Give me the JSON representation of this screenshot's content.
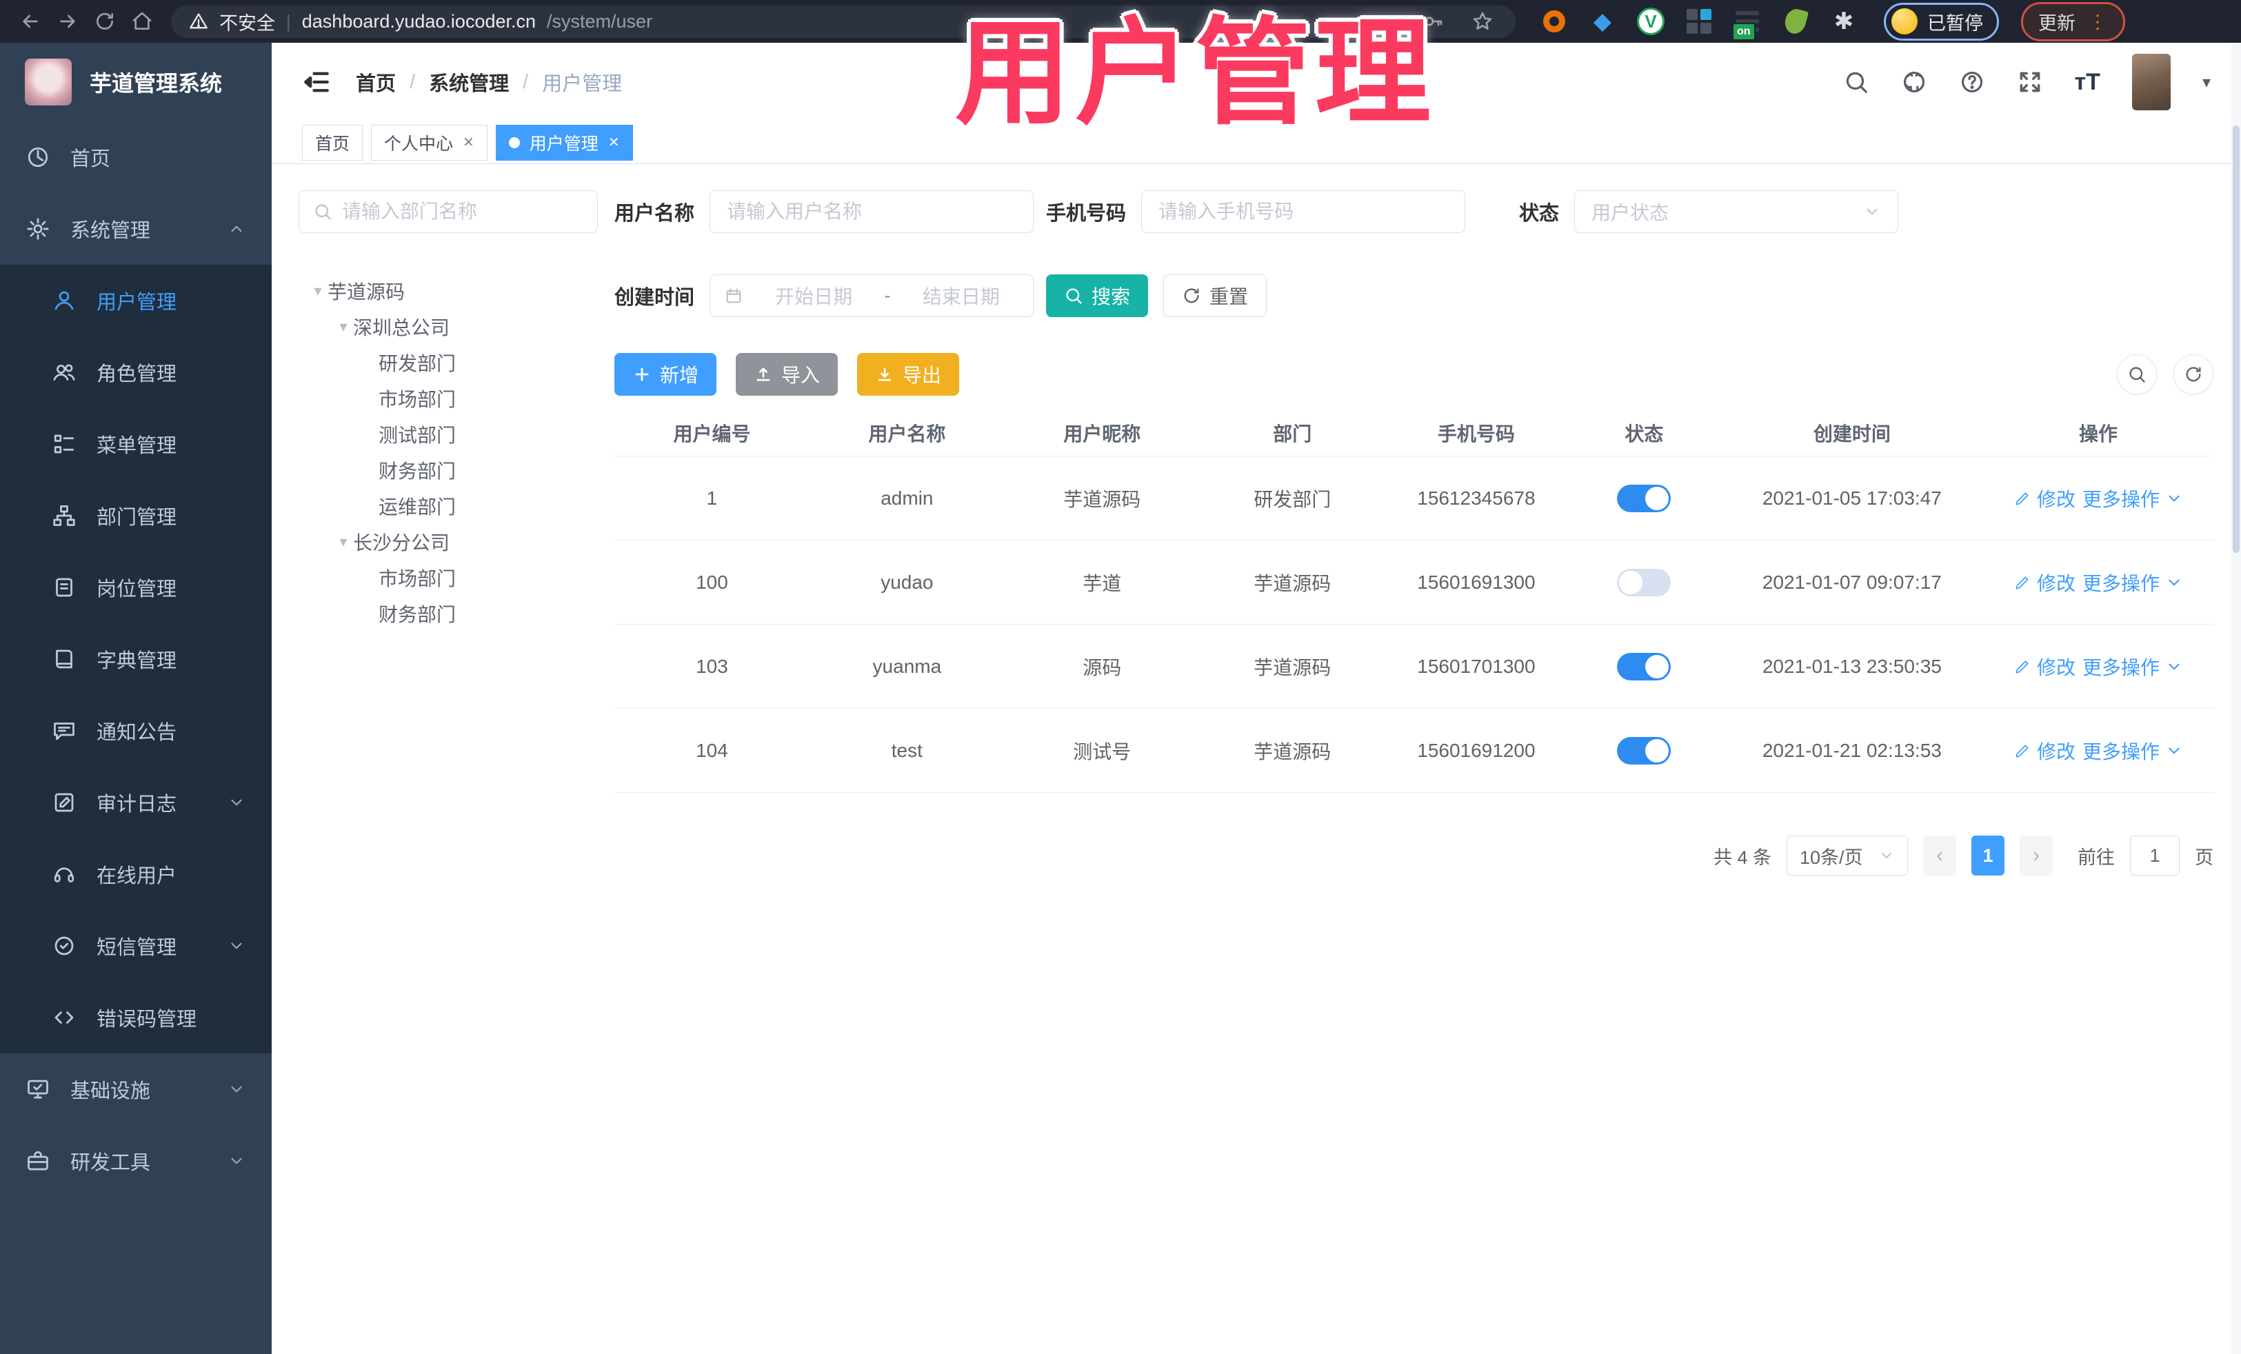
{
  "annotation": {
    "title": "用户管理"
  },
  "browser": {
    "security_label": "不安全",
    "url_host": "dashboard.yudao.iocoder.cn",
    "url_path": "/system/user",
    "ext_on_badge": "on",
    "paused_label": "已暂停",
    "update_label": "更新"
  },
  "sidebar": {
    "logo_title": "芋道管理系统",
    "menu": [
      {
        "key": "home",
        "label": "首页",
        "icon": "dashboard-icon",
        "level": 0
      },
      {
        "key": "system",
        "label": "系统管理",
        "icon": "gear-icon",
        "level": 0,
        "chevron": "up"
      },
      {
        "key": "user",
        "label": "用户管理",
        "icon": "user-icon",
        "level": 1,
        "active": true
      },
      {
        "key": "role",
        "label": "角色管理",
        "icon": "roles-icon",
        "level": 1
      },
      {
        "key": "menu",
        "label": "菜单管理",
        "icon": "menu-tree-icon",
        "level": 1
      },
      {
        "key": "dept",
        "label": "部门管理",
        "icon": "org-icon",
        "level": 1
      },
      {
        "key": "post",
        "label": "岗位管理",
        "icon": "post-icon",
        "level": 1
      },
      {
        "key": "dict",
        "label": "字典管理",
        "icon": "dict-icon",
        "level": 1
      },
      {
        "key": "notice",
        "label": "通知公告",
        "icon": "notice-icon",
        "level": 1
      },
      {
        "key": "audit",
        "label": "审计日志",
        "icon": "audit-icon",
        "level": 1,
        "chevron": "down"
      },
      {
        "key": "online",
        "label": "在线用户",
        "icon": "headset-icon",
        "level": 1
      },
      {
        "key": "sms",
        "label": "短信管理",
        "icon": "badge-check-icon",
        "level": 1,
        "chevron": "down"
      },
      {
        "key": "errcode",
        "label": "错误码管理",
        "icon": "code-icon",
        "level": 1
      },
      {
        "key": "infra",
        "label": "基础设施",
        "icon": "monitor-icon",
        "level": 0,
        "chevron": "down"
      },
      {
        "key": "devtools",
        "label": "研发工具",
        "icon": "toolbox-icon",
        "level": 0,
        "chevron": "down"
      }
    ]
  },
  "header": {
    "breadcrumb": [
      "首页",
      "系统管理",
      "用户管理"
    ]
  },
  "tabs": [
    {
      "key": "home",
      "label": "首页",
      "closable": false,
      "active": false
    },
    {
      "key": "profile",
      "label": "个人中心",
      "closable": true,
      "active": false
    },
    {
      "key": "user",
      "label": "用户管理",
      "closable": true,
      "active": true
    }
  ],
  "dept_panel": {
    "search_placeholder": "请输入部门名称",
    "tree": [
      {
        "label": "芋道源码",
        "level": 0,
        "expandable": true
      },
      {
        "label": "深圳总公司",
        "level": 1,
        "expandable": true
      },
      {
        "label": "研发部门",
        "level": 2,
        "expandable": false
      },
      {
        "label": "市场部门",
        "level": 2,
        "expandable": false
      },
      {
        "label": "测试部门",
        "level": 2,
        "expandable": false
      },
      {
        "label": "财务部门",
        "level": 2,
        "expandable": false
      },
      {
        "label": "运维部门",
        "level": 2,
        "expandable": false
      },
      {
        "label": "长沙分公司",
        "level": 1,
        "expandable": true
      },
      {
        "label": "市场部门",
        "level": 2,
        "expandable": false
      },
      {
        "label": "财务部门",
        "level": 2,
        "expandable": false
      }
    ]
  },
  "filters": {
    "username_label": "用户名称",
    "username_placeholder": "请输入用户名称",
    "mobile_label": "手机号码",
    "mobile_placeholder": "请输入手机号码",
    "status_label": "状态",
    "status_placeholder": "用户状态",
    "create_time_label": "创建时间",
    "date_start_placeholder": "开始日期",
    "date_separator": "-",
    "date_end_placeholder": "结束日期",
    "search_label": "搜索",
    "reset_label": "重置"
  },
  "toolbar": {
    "add_label": "新增",
    "import_label": "导入",
    "export_label": "导出"
  },
  "table": {
    "columns": [
      {
        "label": "用户编号",
        "width": 12.2
      },
      {
        "label": "用户名称",
        "width": 12.2
      },
      {
        "label": "用户昵称",
        "width": 12.2
      },
      {
        "label": "部门",
        "width": 11.6
      },
      {
        "label": "手机号码",
        "width": 11.4
      },
      {
        "label": "状态",
        "width": 9.6
      },
      {
        "label": "创建时间",
        "width": 16.4
      },
      {
        "label": "操作",
        "width": 14.4
      }
    ],
    "rows": [
      {
        "id": "1",
        "username": "admin",
        "nickname": "芋道源码",
        "dept": "研发部门",
        "mobile": "15612345678",
        "status": true,
        "created": "2021-01-05 17:03:47"
      },
      {
        "id": "100",
        "username": "yudao",
        "nickname": "芋道",
        "dept": "芋道源码",
        "mobile": "15601691300",
        "status": false,
        "created": "2021-01-07 09:07:17"
      },
      {
        "id": "103",
        "username": "yuanma",
        "nickname": "源码",
        "dept": "芋道源码",
        "mobile": "15601701300",
        "status": true,
        "created": "2021-01-13 23:50:35"
      },
      {
        "id": "104",
        "username": "test",
        "nickname": "测试号",
        "dept": "芋道源码",
        "mobile": "15601691200",
        "status": true,
        "created": "2021-01-21 02:13:53"
      }
    ]
  },
  "row_actions": {
    "edit_label": "修改",
    "more_label": "更多操作"
  },
  "pagination": {
    "total_label": "共 4 条",
    "page_size_label": "10条/页",
    "prev_glyph": "‹",
    "next_glyph": "›",
    "current_page": "1",
    "goto_label": "前往",
    "goto_value": "1",
    "page_unit": "页"
  }
}
